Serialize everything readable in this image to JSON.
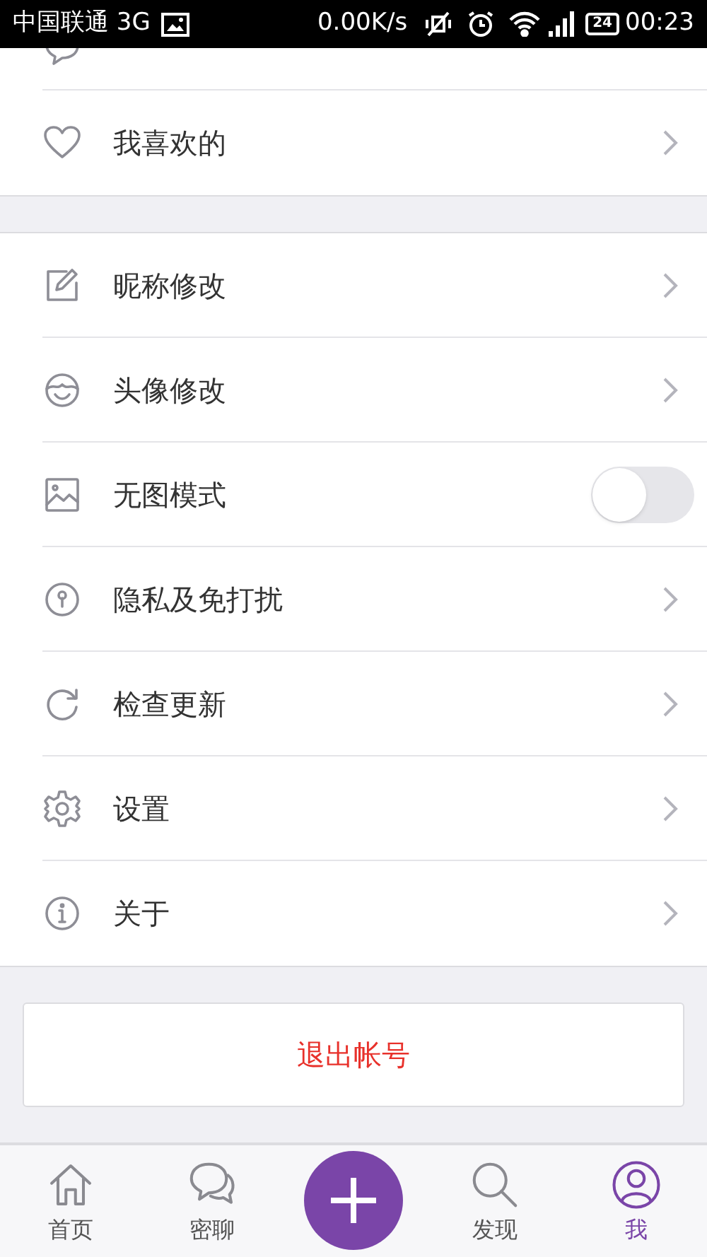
{
  "status_bar": {
    "carrier": "中国联通 3G",
    "speed": "0.00K/s",
    "battery": "24",
    "time": "00:23"
  },
  "groups": [
    {
      "items": [
        {
          "label": "我喜欢的",
          "kind": "link"
        }
      ]
    },
    {
      "items": [
        {
          "label": "昵称修改",
          "kind": "link"
        },
        {
          "label": "头像修改",
          "kind": "link"
        },
        {
          "label": "无图模式",
          "kind": "toggle",
          "on": false
        },
        {
          "label": "隐私及免打扰",
          "kind": "link"
        },
        {
          "label": "检查更新",
          "kind": "link"
        },
        {
          "label": "设置",
          "kind": "link"
        },
        {
          "label": "关于",
          "kind": "link"
        }
      ]
    }
  ],
  "logout": "退出帐号",
  "nav": [
    {
      "label": "首页",
      "selected": false,
      "kind": "tab"
    },
    {
      "label": "密聊",
      "selected": false,
      "kind": "tab"
    },
    {
      "kind": "action"
    },
    {
      "label": "发现",
      "selected": false,
      "kind": "tab"
    },
    {
      "label": "我",
      "selected": true,
      "kind": "tab"
    }
  ]
}
